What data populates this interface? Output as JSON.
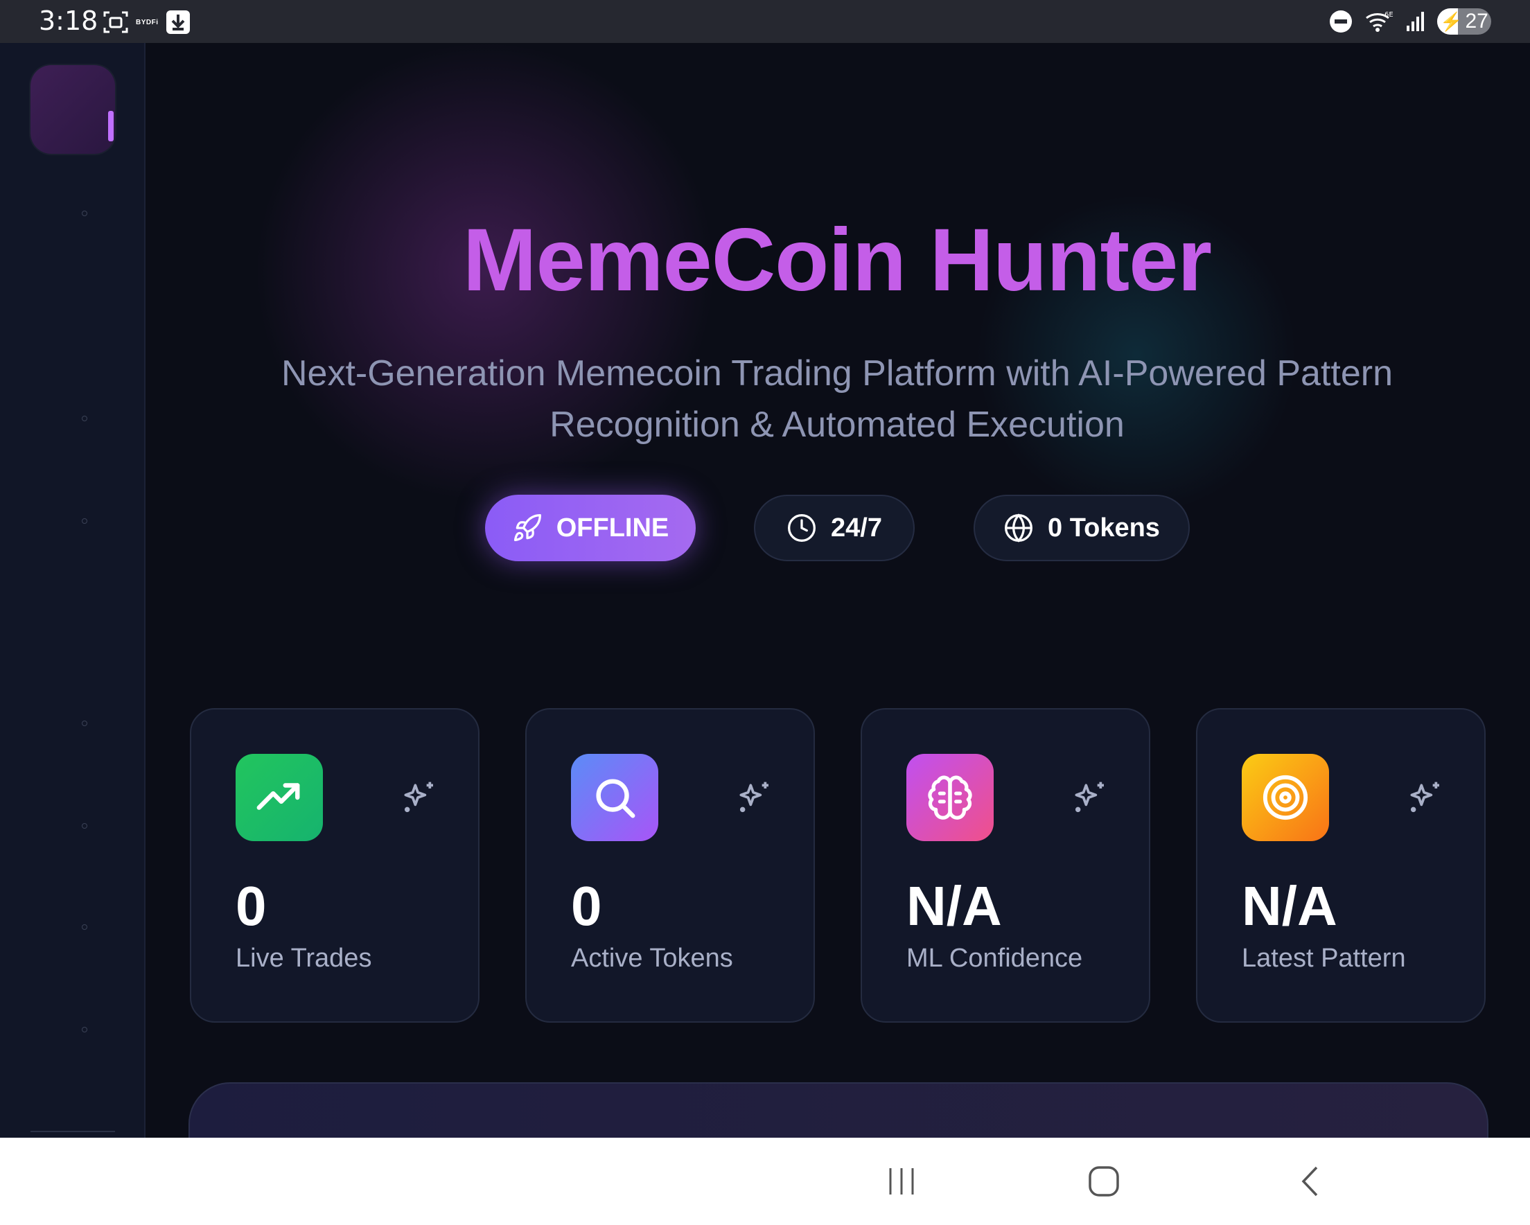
{
  "status_bar": {
    "time": "3:18",
    "brand_badge": "BYDFi",
    "signal_label": "6E",
    "battery_level": "27"
  },
  "hero": {
    "title": "MemeCoin Hunter",
    "subtitle_line1": "Next-Generation Memecoin Trading Platform with AI-Powered Pattern",
    "subtitle_line2": "Recognition & Automated Execution"
  },
  "pills": [
    {
      "label": "OFFLINE",
      "icon": "rocket-icon"
    },
    {
      "label": "24/7",
      "icon": "clock-icon"
    },
    {
      "label": "0 Tokens",
      "icon": "globe-icon"
    }
  ],
  "stats": [
    {
      "value": "0",
      "label": "Live Trades",
      "icon": "trending-up-icon",
      "color_from": "#22c55e",
      "color_to": "#16b36e"
    },
    {
      "value": "0",
      "label": "Active Tokens",
      "icon": "search-icon",
      "color_from": "#5b8cf7",
      "color_to": "#a855f7"
    },
    {
      "value": "N/A",
      "label": "ML Confidence",
      "icon": "brain-icon",
      "color_from": "#c050f0",
      "color_to": "#f0508a"
    },
    {
      "value": "N/A",
      "label": "Latest Pattern",
      "icon": "target-icon",
      "color_from": "#facc15",
      "color_to": "#f97316"
    }
  ],
  "colors": {
    "accent": "#8b5cf6",
    "title": "#c45ee8",
    "background": "#0b0d17"
  }
}
